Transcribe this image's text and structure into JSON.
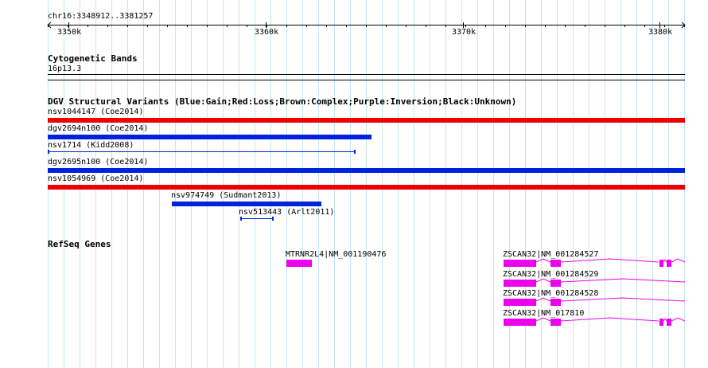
{
  "ruler": {
    "region_label": "chr16:3348912..3381257",
    "ticks": [
      {
        "pos": 3350000,
        "label": "3350k"
      },
      {
        "pos": 3360000,
        "label": "3360k"
      },
      {
        "pos": 3370000,
        "label": "3370k"
      },
      {
        "pos": 3380000,
        "label": "3380k"
      }
    ]
  },
  "cytobands": {
    "title": "Cytogenetic Bands",
    "band_label": "16p13.3"
  },
  "dgv": {
    "title": "DGV Structural Variants (Blue:Gain;Red:Loss;Brown:Complex;Purple:Inversion;Black:Unknown)",
    "colors": {
      "gain": "#0022dd",
      "loss": "#ee0000"
    },
    "features": [
      {
        "label": "nsv1044147 (Coe2014)",
        "type": "loss",
        "style": "thick"
      },
      {
        "label": "dgv2694n100 (Coe2014)",
        "type": "gain",
        "style": "thick"
      },
      {
        "label": "nsv1714 (Kidd2008)",
        "type": "gain",
        "style": "thin"
      },
      {
        "label": "dgv2695n100 (Coe2014)",
        "type": "gain",
        "style": "thick"
      },
      {
        "label": "nsv1054969 (Coe2014)",
        "type": "loss",
        "style": "thick"
      },
      {
        "label": "nsv974749 (Sudmant2013)",
        "type": "gain",
        "style": "thick"
      },
      {
        "label": "nsv513443 (Arlt2011)",
        "type": "gain",
        "style": "thin"
      }
    ]
  },
  "refseq": {
    "title": "RefSeq Genes",
    "color": "#ee00ee",
    "genes": [
      {
        "label": "MTRNR2L4|NM_001190476"
      },
      {
        "label": "ZSCAN32|NM_001284527"
      },
      {
        "label": "ZSCAN32|NM_001284529"
      },
      {
        "label": "ZSCAN32|NM_001284528"
      },
      {
        "label": "ZSCAN32|NM_017810"
      }
    ]
  }
}
